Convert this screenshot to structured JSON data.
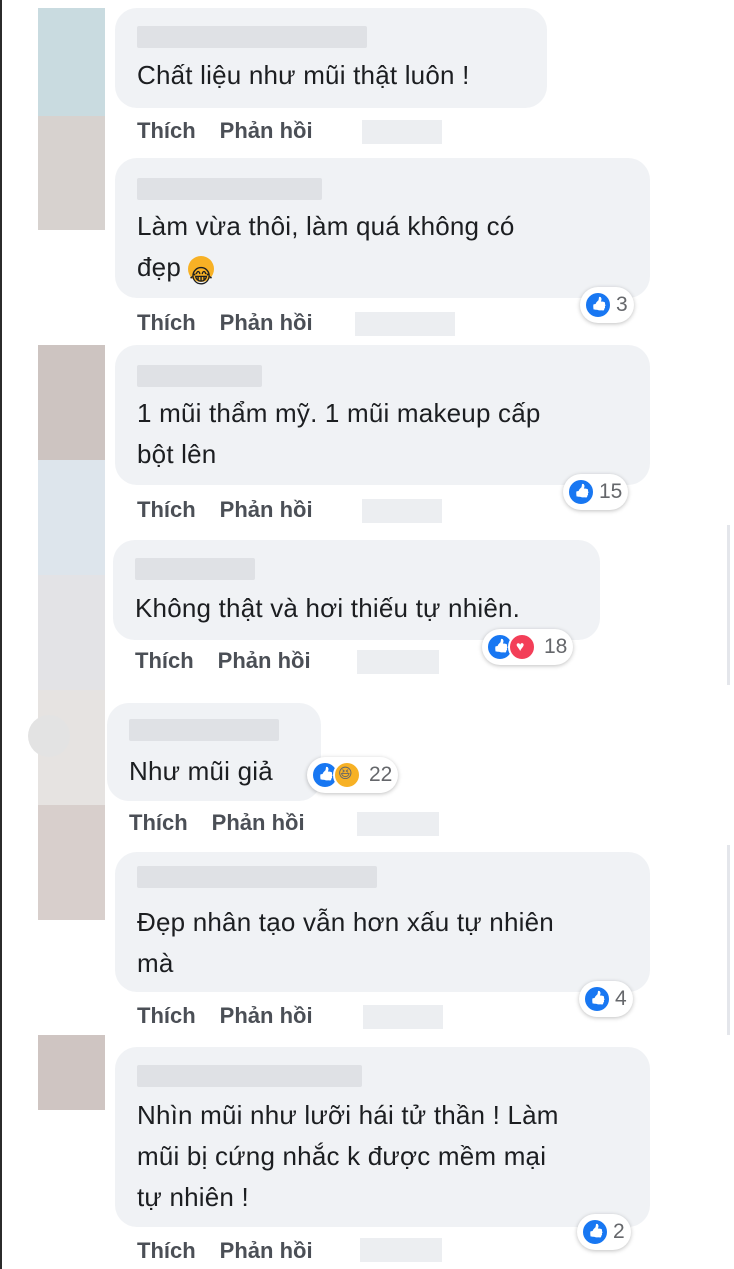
{
  "action_like": "Thích",
  "action_reply": "Phản hồi",
  "comments": [
    {
      "text": "Chất liệu như mũi thật luôn !",
      "reaction_count": ""
    },
    {
      "text1": "Làm vừa thôi, làm quá không có",
      "text2": "đẹp",
      "reaction_count": "3"
    },
    {
      "text1": "1 mũi thẩm mỹ. 1 mũi makeup cấp",
      "text2": "bột lên",
      "reaction_count": "15"
    },
    {
      "text": "Không thật và hơi thiếu tự nhiên.",
      "reaction_count": "18"
    },
    {
      "text": "Như mũi giả",
      "reaction_count": "22"
    },
    {
      "text1": "Đẹp nhân tạo vẫn hơn xấu tự nhiên",
      "text2": "mà",
      "reaction_count": "4"
    },
    {
      "text1": "Nhìn mũi như lưỡi hái tử thần ! Làm",
      "text2": "mũi bị cứng nhắc k được mềm mại",
      "text3": "tự nhiên !",
      "reaction_count": "2"
    }
  ],
  "colors": {
    "bubble": "#f0f2f5",
    "like_blue": "#1877f2",
    "love_red": "#f33e58",
    "haha_yellow": "#f7b125"
  },
  "icons": [
    "like-icon",
    "love-icon",
    "haha-icon",
    "laughing-emoji"
  ]
}
